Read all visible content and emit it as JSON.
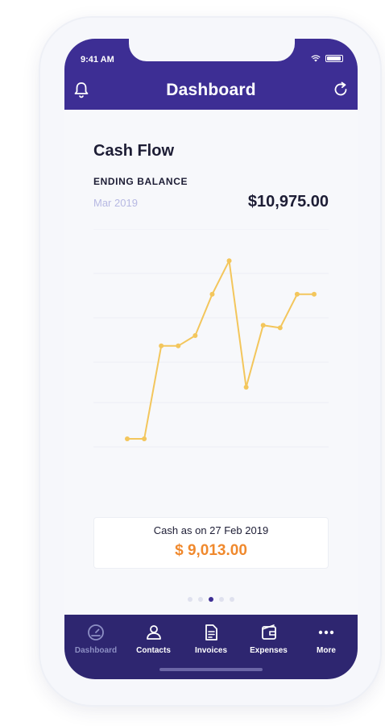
{
  "status_bar": {
    "time": "9:41 AM"
  },
  "header": {
    "title": "Dashboard",
    "left_icon": "bell-icon",
    "right_icon": "refresh-icon"
  },
  "cash_flow": {
    "title": "Cash Flow",
    "ending_balance_label": "ENDING BALANCE",
    "period": "Mar 2019",
    "ending_balance_value": "$10,975.00",
    "line_color": "#f3c65c"
  },
  "chart_data": {
    "type": "line",
    "y": [
      0,
      0,
      36,
      36,
      40,
      56,
      69,
      20,
      44,
      43,
      56,
      56
    ]
  },
  "cash_summary": {
    "label": "Cash as on 27 Feb 2019",
    "value": "$ 9,013.00",
    "value_color": "#f0892d"
  },
  "pager": {
    "count": 5,
    "active_index": 2
  },
  "tabbar": {
    "items": [
      {
        "label": "Dashboard",
        "icon": "dashboard-icon",
        "active": true
      },
      {
        "label": "Contacts",
        "icon": "contacts-icon",
        "active": false
      },
      {
        "label": "Invoices",
        "icon": "invoices-icon",
        "active": false
      },
      {
        "label": "Expenses",
        "icon": "expenses-icon",
        "active": false
      },
      {
        "label": "More",
        "icon": "more-icon",
        "active": false
      }
    ]
  },
  "theme": {
    "primary": "#3d2e94",
    "tabbar_bg": "#2e2670"
  }
}
